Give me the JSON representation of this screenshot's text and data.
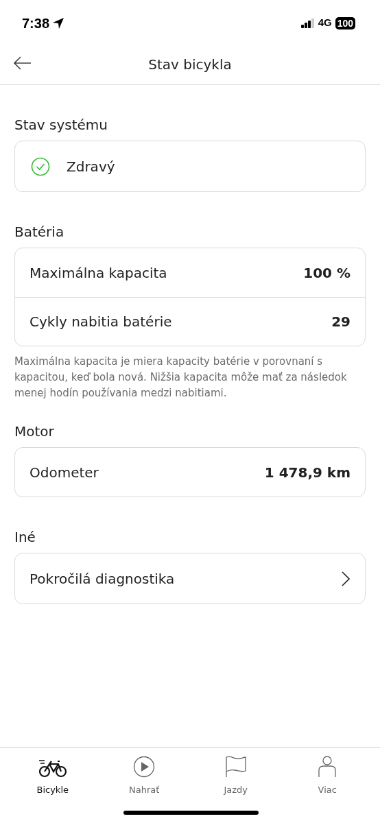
{
  "status_bar": {
    "time": "7:38",
    "network": "4G",
    "battery": "100"
  },
  "header": {
    "title": "Stav bicykla"
  },
  "sections": [
    {
      "title": "Stav systému",
      "kind": "status",
      "status": "Zdravý",
      "healthy": true
    },
    {
      "title": "Batéria",
      "kind": "rows",
      "rows": [
        {
          "label": "Maximálna kapacita",
          "value": "100 %"
        },
        {
          "label": "Cykly nabitia batérie",
          "value": "29"
        }
      ],
      "note": "Maximálna kapacita je miera kapacity batérie v porovnaní s kapacitou, keď bola nová. Nižšia kapacita môže mať za následok menej hodín používania medzi nabitiami."
    },
    {
      "title": "Motor",
      "kind": "rows",
      "rows": [
        {
          "label": "Odometer",
          "value": "1 478,9 km"
        }
      ]
    },
    {
      "title": "Iné",
      "kind": "link",
      "label": "Pokročilá diagnostika"
    }
  ],
  "tabs": [
    {
      "label": "Bicykle",
      "selected": true
    },
    {
      "label": "Nahrať",
      "selected": false
    },
    {
      "label": "Jazdy",
      "selected": false
    },
    {
      "label": "Viac",
      "selected": false
    }
  ]
}
